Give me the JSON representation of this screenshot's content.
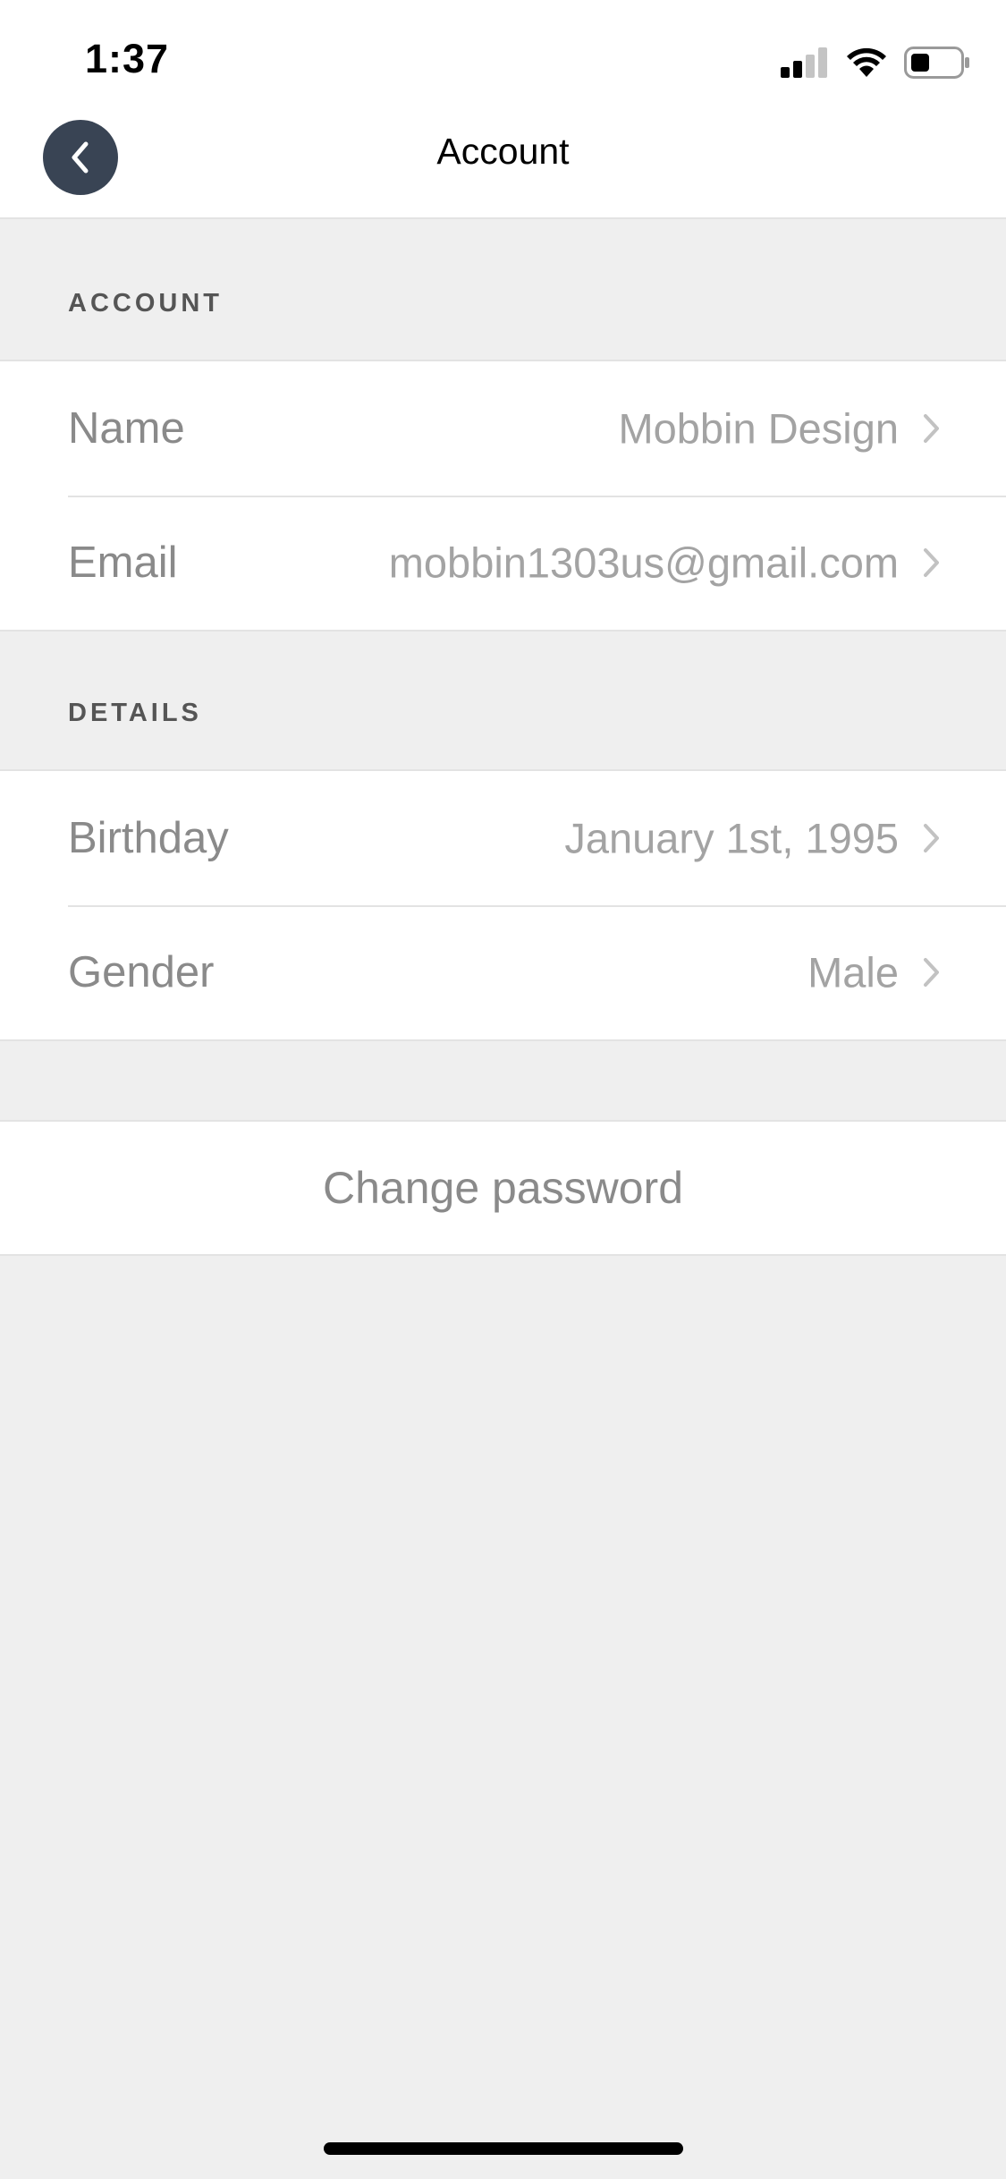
{
  "status_bar": {
    "time": "1:37",
    "icons": [
      "cellular-signal-icon",
      "wifi-icon",
      "battery-icon"
    ]
  },
  "nav": {
    "back_icon": "chevron-left-icon",
    "title": "Account"
  },
  "sections": {
    "account": {
      "header": "ACCOUNT",
      "rows": [
        {
          "label": "Name",
          "value": "Mobbin Design"
        },
        {
          "label": "Email",
          "value": "mobbin1303us@gmail.com"
        }
      ]
    },
    "details": {
      "header": "DETAILS",
      "rows": [
        {
          "label": "Birthday",
          "value": "January 1st, 1995"
        },
        {
          "label": "Gender",
          "value": "Male"
        }
      ]
    }
  },
  "actions": {
    "change_password": "Change password"
  },
  "colors": {
    "back_button_bg": "#394454",
    "background": "#efefef",
    "label_text": "#8a8a8a",
    "value_text": "#a3a3a3",
    "section_header_text": "#555555"
  }
}
